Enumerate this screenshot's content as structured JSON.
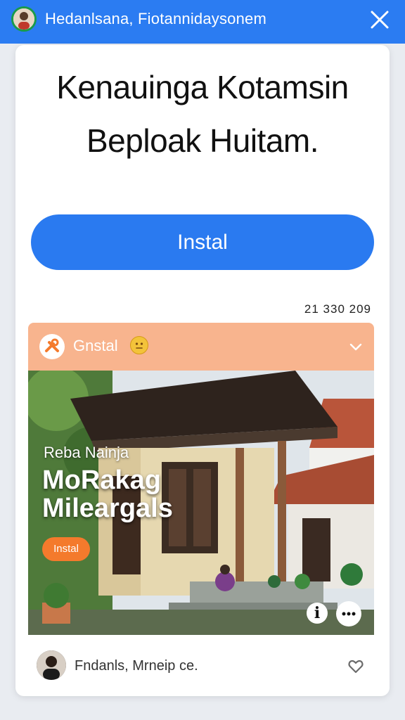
{
  "header": {
    "title": "Hedanlsana, Fiotannidaysonem",
    "avatar_icon": "user-avatar-icon",
    "close_icon": "close-icon",
    "color": "#2b7cf2"
  },
  "main": {
    "headline_line1": "Kenauinga Kotamsin",
    "headline_line2": "Beploak Huitam.",
    "install_label": "Instal",
    "stamp": "21 330 209"
  },
  "ad": {
    "header_label": "Gnstal",
    "header_color": "#f8b48e",
    "logo_icon": "tools-logo-icon",
    "emoji_icon": "face-emoji-icon",
    "chevron_icon": "chevron-down-icon",
    "kicker": "Reba Nainja",
    "title_line1": "MoRakag",
    "title_line2": "Mileargals",
    "cta_label": "Instal",
    "cta_color": "#f47a2c",
    "info_label": "i",
    "more_icon": "more-icon"
  },
  "footer": {
    "name": "Fndanls, Mrneip ce.",
    "heart_icon": "heart-icon"
  }
}
